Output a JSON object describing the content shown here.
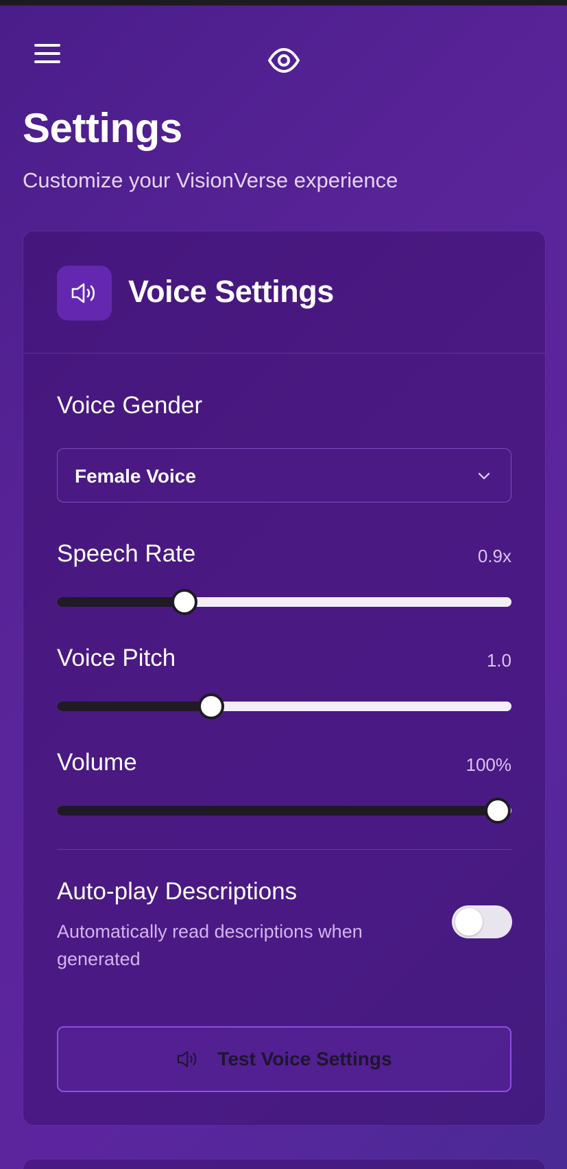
{
  "header": {
    "menu_icon": "hamburger-menu-icon",
    "logo_icon": "eye-icon"
  },
  "page": {
    "title": "Settings",
    "subtitle": "Customize your VisionVerse experience"
  },
  "voice_settings": {
    "icon": "speaker-icon",
    "title": "Voice Settings",
    "gender": {
      "label": "Voice Gender",
      "selected": "Female Voice"
    },
    "speech_rate": {
      "label": "Speech Rate",
      "value_text": "0.9x",
      "fraction": 0.28
    },
    "voice_pitch": {
      "label": "Voice Pitch",
      "value_text": "1.0",
      "fraction": 0.34
    },
    "volume": {
      "label": "Volume",
      "value_text": "100%",
      "fraction": 0.97
    },
    "autoplay": {
      "label": "Auto-play Descriptions",
      "description": "Automatically read descriptions when generated",
      "enabled": false
    },
    "test_button": {
      "label": "Test Voice Settings",
      "icon": "speaker-icon"
    }
  },
  "colors": {
    "accent": "#6428b0",
    "background": "#5a2499",
    "button_border": "#8f4fe0"
  }
}
